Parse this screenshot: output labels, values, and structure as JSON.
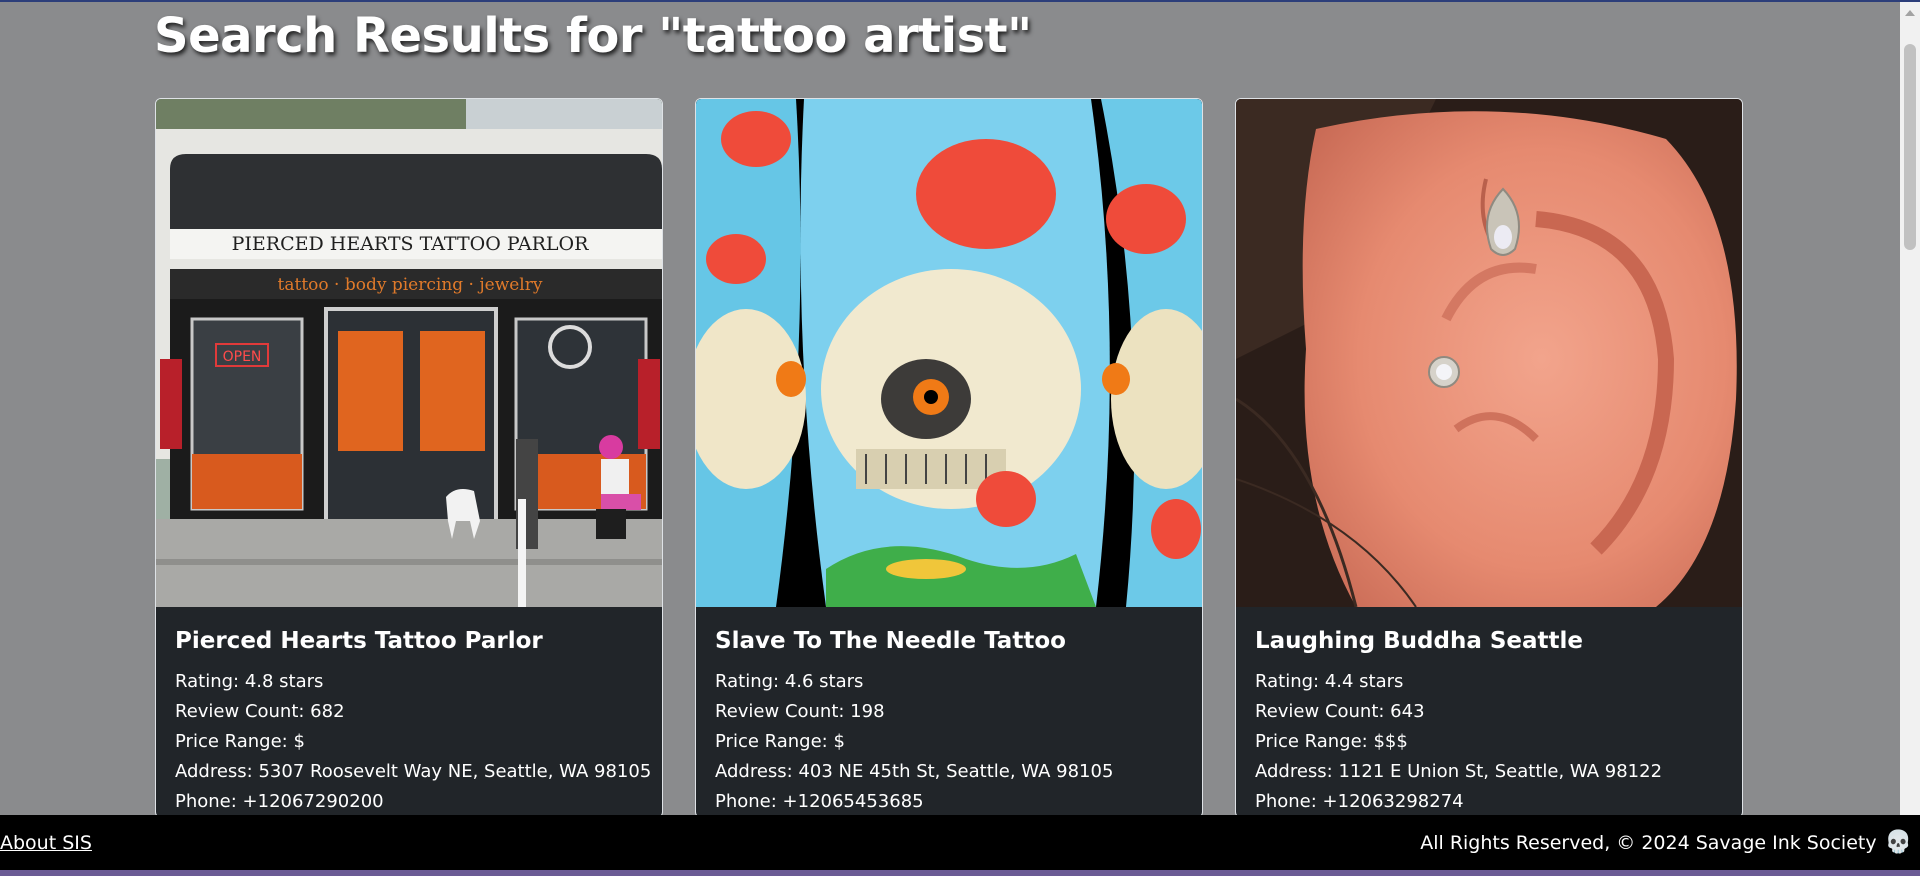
{
  "page": {
    "title": "Search Results for \"tattoo artist\""
  },
  "results": [
    {
      "name": "Pierced Hearts Tattoo Parlor",
      "image_alt": "storefront",
      "storefront_sign": "PIERCED HEARTS TATTOO PARLOR",
      "storefront_subsign": "tattoo · body piercing · jewelry",
      "storefront_open": "OPEN",
      "rating": "Rating: 4.8 stars",
      "review_count": "Review Count: 682",
      "price_range": "Price Range: $",
      "address": "Address: 5307 Roosevelt Way NE, Seattle, WA 98105",
      "phone": "Phone: +12067290200"
    },
    {
      "name": "Slave To The Needle Tattoo",
      "image_alt": "skull tattoo",
      "rating": "Rating: 4.6 stars",
      "review_count": "Review Count: 198",
      "price_range": "Price Range: $",
      "address": "Address: 403 NE 45th St, Seattle, WA 98105",
      "phone": "Phone: +12065453685"
    },
    {
      "name": "Laughing Buddha Seattle",
      "image_alt": "ear piercing",
      "rating": "Rating: 4.4 stars",
      "review_count": "Review Count: 643",
      "price_range": "Price Range: $$$",
      "address": "Address: 1121 E Union St, Seattle, WA 98122",
      "phone": "Phone: +12063298274"
    }
  ],
  "footer": {
    "about_link": "About SIS",
    "copyright": "All Rights Reserved, © 2024 Savage Ink Society",
    "icon": "skull-icon"
  },
  "colors": {
    "page_background": "#8a8b8d",
    "card_background": "#212529",
    "footer_background": "#000000"
  }
}
